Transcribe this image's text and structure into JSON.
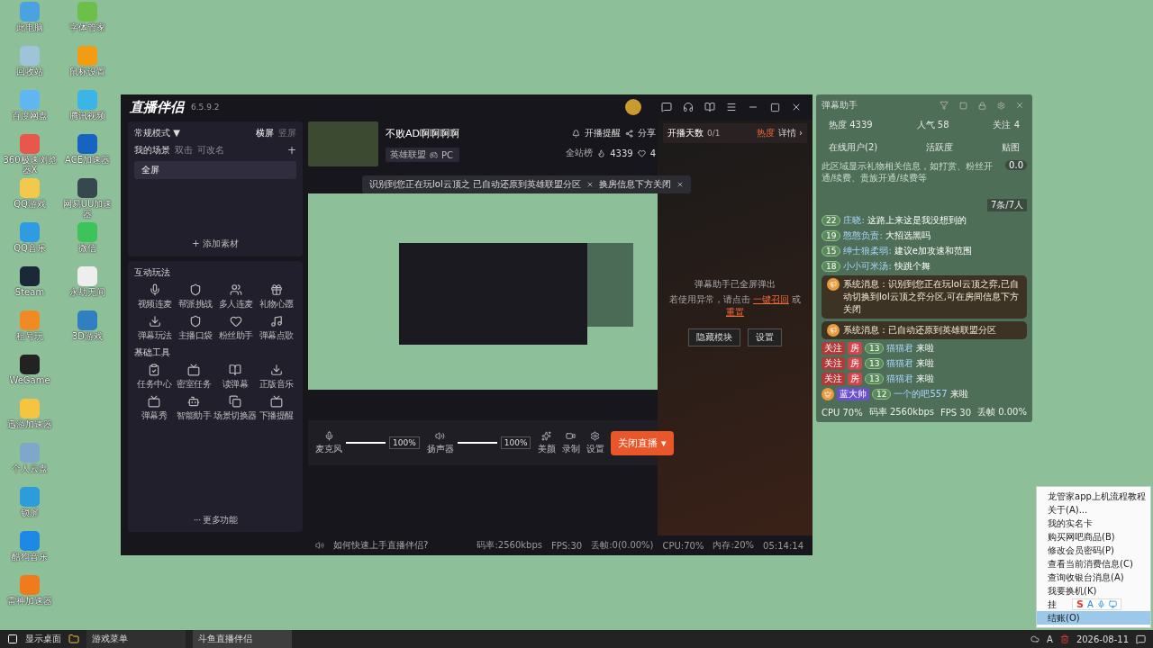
{
  "desktop": {
    "icon_columns": [
      [
        {
          "label": "此电脑",
          "color": "#4aa3df"
        },
        {
          "label": "回收站",
          "color": "#9fc3d9"
        },
        {
          "label": "百度网盘",
          "color": "#5fb6f0"
        },
        {
          "label": "360极速浏览器X",
          "color": "#e8574c"
        },
        {
          "label": "QQ游戏",
          "color": "#f2c94c"
        },
        {
          "label": "QQ音乐",
          "color": "#2f9be0"
        },
        {
          "label": "Steam",
          "color": "#1b2838"
        },
        {
          "label": "租号玩",
          "color": "#f08a24"
        },
        {
          "label": "WeGame",
          "color": "#222222"
        },
        {
          "label": "迅游加速器",
          "color": "#f5c542"
        },
        {
          "label": "个人云盘",
          "color": "#7fa7c9"
        },
        {
          "label": "锁屏",
          "color": "#2d9cdb"
        },
        {
          "label": "酷狗音乐",
          "color": "#1e88e5"
        },
        {
          "label": "雷神加速器",
          "color": "#f07b1d"
        }
      ],
      [
        {
          "label": "字体管家",
          "color": "#6cc04a"
        },
        {
          "label": "鼠标设置",
          "color": "#f39c12"
        },
        {
          "label": "腾讯视频",
          "color": "#3bb5e8"
        },
        {
          "label": "ACE加速器",
          "color": "#1565c0"
        },
        {
          "label": "网易UU加速器",
          "color": "#37474f"
        },
        {
          "label": "微信",
          "color": "#3cc45b"
        },
        {
          "label": "永劫无间",
          "color": "#eeeeee"
        },
        {
          "label": "3D游戏",
          "color": "#2f7fc1"
        }
      ]
    ]
  },
  "main_window": {
    "app_name": "直播伴侣",
    "version": "6.5.9.2",
    "mode": "常规模式 ▼",
    "orientations": [
      {
        "label": "横屏",
        "selected": true
      },
      {
        "label": "竖屏",
        "selected": false
      }
    ],
    "scenes": {
      "title": "我的场景",
      "hints": [
        "双击",
        "可改名"
      ],
      "add": "+",
      "items": [
        {
          "label": "全屏",
          "selected": true
        }
      ],
      "add_source": "+ 添加素材"
    },
    "sections": [
      {
        "title": "互动玩法",
        "items": [
          "视频连麦",
          "帮派挑战",
          "多人连麦",
          "礼物心愿",
          "弹幕玩法",
          "主播口袋",
          "粉丝助手",
          "弹幕点歌"
        ]
      },
      {
        "title": "基础工具",
        "items": [
          "任务中心",
          "密室任务",
          "读弹幕",
          "正版音乐",
          "弹幕秀",
          "智能助手",
          "场景切换器",
          "下播提醒"
        ]
      }
    ],
    "more": "··· 更多功能",
    "room": {
      "title": "不败AD啊啊啊啊",
      "category": "英雄联盟",
      "platform": "PC",
      "remind": "开播提醒",
      "share": "分享",
      "rank": "全站榜",
      "heat": "4339",
      "likes": "4"
    },
    "notice": {
      "parts": [
        "识别到您正在玩lol云顶之  已自动还原到英雄联盟分区",
        "换房信息下方关闭"
      ]
    },
    "controls": [
      {
        "kind": "slider",
        "label": "麦克风",
        "level": 1,
        "reading": "100%"
      },
      {
        "kind": "slider",
        "label": "扬声器",
        "level": 1,
        "reading": "100%"
      },
      {
        "kind": "button",
        "label": "美颜"
      },
      {
        "kind": "button",
        "label": "录制"
      },
      {
        "kind": "button",
        "label": "设置"
      }
    ],
    "stop_button": "关闭直播 ▾",
    "status": {
      "help": "如何快速上手直播伴侣?",
      "items": [
        "码率:2560kbps",
        "FPS:30",
        "丢帧:0(0.00%)",
        "CPU:70%",
        "内存:20%",
        "05:14:14"
      ]
    },
    "side": {
      "days_label": "开播天数",
      "days": "0/1",
      "hot": "热度",
      "detail": "详情 ›",
      "notice_1": "弹幕助手已全屏弹出",
      "notice_2": "若使用异常，请点击",
      "recall": "一键召回",
      "or": "或",
      "reset": "重置",
      "buttons": [
        "隐藏模块",
        "设置"
      ]
    }
  },
  "danmu_panel": {
    "title": "弹幕助手",
    "stats": [
      "热度 4339",
      "人气 58",
      "关注 4"
    ],
    "tabs": [
      "在线用户(2)",
      "活跃度",
      "贴图"
    ],
    "gift_hint": "此区域显示礼物相关信息，如打赏、粉丝开通/续费、贵族开通/续费等",
    "gift_value": "0.0",
    "count": "7条/7人",
    "messages": [
      {
        "kind": "chat",
        "level": "22",
        "name": "庄晓:",
        "text": "这路上来这是我没想到的"
      },
      {
        "kind": "chat",
        "level": "19",
        "name": "憨憨负责:",
        "text": "大招选黑吗"
      },
      {
        "kind": "chat",
        "level": "15",
        "name": "绅士狼柔弱:",
        "text": "建议e加攻速和范围"
      },
      {
        "kind": "chat",
        "level": "18",
        "name": "小小可米汤:",
        "text": "快跳个舞"
      },
      {
        "kind": "system",
        "text": "系统消息：识别到您正在玩lol云顶之弈,已自动切换到lol云顶之弈分区,可在房间信息下方关闭"
      },
      {
        "kind": "system",
        "text": "系统消息：已自动还原到英雄联盟分区"
      },
      {
        "kind": "enter",
        "tag": "关注",
        "room": "房",
        "level": "13",
        "name": "猫猫君",
        "text": "来啦"
      },
      {
        "kind": "enter",
        "tag": "关注",
        "room": "房",
        "level": "13",
        "name": "猫猫君",
        "text": "来啦"
      },
      {
        "kind": "enter",
        "tag": "关注",
        "room": "房",
        "level": "13",
        "name": "猫猫君",
        "text": "来啦"
      },
      {
        "kind": "noble",
        "tag": "蓝大帅",
        "level": "12",
        "name": "一个的吧557",
        "text": "来啦"
      }
    ],
    "footer": [
      "CPU 70%",
      "码率 2560kbps",
      "FPS 30",
      "丢帧 0.00%"
    ]
  },
  "tray_menu": {
    "items": [
      {
        "label": "龙管家app上机流程教程",
        "selected": false
      },
      {
        "label": "关于(A)...",
        "selected": false
      },
      {
        "label": "我的实名卡",
        "selected": false
      },
      {
        "label": "购买网吧商品(B)",
        "selected": false
      },
      {
        "label": "修改会员密码(P)",
        "selected": false
      },
      {
        "label": "查看当前消费信息(C)",
        "selected": false
      },
      {
        "label": "查询收银台消息(A)",
        "selected": false
      },
      {
        "label": "我要换机(K)",
        "selected": false
      },
      {
        "label": "挂",
        "selected": false
      },
      {
        "label": "结账(O)",
        "selected": true
      }
    ],
    "ime_logo": "S",
    "ime_letter": "A"
  },
  "taskbar": {
    "show_desktop": "显示桌面",
    "tasks": [
      {
        "label": "游戏菜单",
        "selected": false
      },
      {
        "label": "斗鱼直播伴侣",
        "selected": true
      }
    ],
    "tray_letter": "A",
    "date": "2026-08-11"
  }
}
